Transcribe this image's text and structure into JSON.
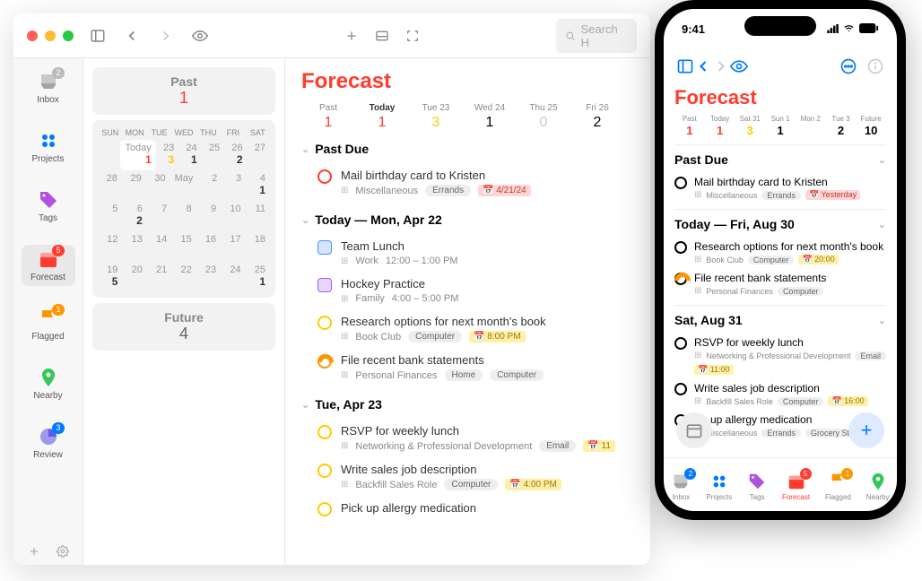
{
  "mac": {
    "search_placeholder": "Search H",
    "sidebar": [
      {
        "label": "Inbox",
        "badge": "2",
        "badgeColor": "",
        "icon": "inbox"
      },
      {
        "label": "Projects",
        "badge": "",
        "icon": "projects"
      },
      {
        "label": "Tags",
        "badge": "",
        "icon": "tags"
      },
      {
        "label": "Forecast",
        "badge": "5",
        "badgeColor": "red",
        "icon": "forecast",
        "selected": true
      },
      {
        "label": "Flagged",
        "badge": "1",
        "badgeColor": "orange",
        "icon": "flagged"
      },
      {
        "label": "Nearby",
        "badge": "",
        "icon": "nearby"
      },
      {
        "label": "Review",
        "badge": "3",
        "badgeColor": "blue",
        "icon": "review"
      }
    ],
    "past_title": "Past",
    "past_count": "1",
    "future_title": "Future",
    "future_count": "4",
    "cal_dow": [
      "SUN",
      "MON",
      "TUE",
      "WED",
      "THU",
      "FRI",
      "SAT"
    ],
    "cal_weeks": [
      [
        {
          "d": "",
          "n": ""
        },
        {
          "d": "Today",
          "n": "1",
          "c": "n-red",
          "today": true
        },
        {
          "d": "23",
          "n": "3",
          "c": "n-yellow"
        },
        {
          "d": "24",
          "n": "1",
          "c": ""
        },
        {
          "d": "25",
          "n": "",
          "c": ""
        },
        {
          "d": "26",
          "n": "2",
          "c": ""
        },
        {
          "d": "27",
          "n": ""
        }
      ],
      [
        {
          "d": "28",
          "n": ""
        },
        {
          "d": "29",
          "n": ""
        },
        {
          "d": "30",
          "n": ""
        },
        {
          "d": "May",
          "n": ""
        },
        {
          "d": "2",
          "n": ""
        },
        {
          "d": "3",
          "n": ""
        },
        {
          "d": "4",
          "n": "1",
          "c": ""
        }
      ],
      [
        {
          "d": "5",
          "n": ""
        },
        {
          "d": "6",
          "n": "2"
        },
        {
          "d": "7",
          "n": ""
        },
        {
          "d": "8",
          "n": ""
        },
        {
          "d": "9",
          "n": ""
        },
        {
          "d": "10",
          "n": ""
        },
        {
          "d": "11",
          "n": ""
        }
      ],
      [
        {
          "d": "12",
          "n": ""
        },
        {
          "d": "13",
          "n": ""
        },
        {
          "d": "14",
          "n": ""
        },
        {
          "d": "15",
          "n": ""
        },
        {
          "d": "16",
          "n": ""
        },
        {
          "d": "17",
          "n": ""
        },
        {
          "d": "18",
          "n": ""
        }
      ],
      [
        {
          "d": "19",
          "n": "5",
          "c": ""
        },
        {
          "d": "20",
          "n": ""
        },
        {
          "d": "21",
          "n": ""
        },
        {
          "d": "22",
          "n": ""
        },
        {
          "d": "23",
          "n": ""
        },
        {
          "d": "24",
          "n": ""
        },
        {
          "d": "25",
          "n": "1",
          "c": ""
        }
      ]
    ],
    "forecast_title": "Forecast",
    "fc_dates": [
      {
        "lbl": "Past",
        "num": "1",
        "c": "n-red"
      },
      {
        "lbl": "Today",
        "num": "1",
        "c": "n-red",
        "bold": true
      },
      {
        "lbl": "Tue 23",
        "num": "3",
        "c": "n-yellow"
      },
      {
        "lbl": "Wed 24",
        "num": "1",
        "c": ""
      },
      {
        "lbl": "Thu 25",
        "num": "0",
        "c": "",
        "muted": true
      },
      {
        "lbl": "Fri 26",
        "num": "2",
        "c": ""
      }
    ],
    "sections": [
      {
        "title": "Past Due",
        "items": [
          {
            "kind": "task",
            "circle": "tc-red",
            "title": "Mail birthday card to Kristen",
            "proj": "Miscellaneous",
            "tags": [
              "Errands"
            ],
            "due": "4/21/24",
            "dueRed": true
          }
        ]
      },
      {
        "title": "Today — Mon, Apr 22",
        "items": [
          {
            "kind": "event",
            "ev": "te-blue",
            "title": "Team Lunch",
            "proj": "Work",
            "time": "12:00 – 1:00 PM"
          },
          {
            "kind": "event",
            "ev": "te-purple",
            "title": "Hockey Practice",
            "proj": "Family",
            "time": "4:00 – 5:00 PM"
          },
          {
            "kind": "task",
            "circle": "tc-yellow",
            "title": "Research options for next month's book",
            "proj": "Book Club",
            "tags": [
              "Computer"
            ],
            "due": "8:00 PM"
          },
          {
            "kind": "task",
            "circle": "tc-orange",
            "ring": true,
            "title": "File recent bank statements",
            "proj": "Personal Finances",
            "tags": [
              "Home",
              "Computer"
            ]
          }
        ]
      },
      {
        "title": "Tue, Apr 23",
        "items": [
          {
            "kind": "task",
            "circle": "tc-yellow",
            "title": "RSVP for weekly lunch",
            "proj": "Networking & Professional Development",
            "tags": [
              "Email"
            ],
            "due": "11"
          },
          {
            "kind": "task",
            "circle": "tc-yellow",
            "title": "Write sales job description",
            "proj": "Backfill Sales Role",
            "tags": [
              "Computer"
            ],
            "due": "4:00 PM"
          },
          {
            "kind": "task",
            "circle": "tc-yellow",
            "title": "Pick up allergy medication"
          }
        ]
      }
    ]
  },
  "phone": {
    "time": "9:41",
    "forecast_title": "Forecast",
    "dates": [
      {
        "lbl": "Past",
        "num": "1",
        "c": "n-red"
      },
      {
        "lbl": "Today",
        "num": "1",
        "c": "n-red"
      },
      {
        "lbl": "Sat 31",
        "num": "3",
        "c": "n-yellow"
      },
      {
        "lbl": "Sun 1",
        "num": "1"
      },
      {
        "lbl": "Mon 2",
        "num": ""
      },
      {
        "lbl": "Tue 3",
        "num": "2"
      },
      {
        "lbl": "Future",
        "num": "10"
      }
    ],
    "sections": [
      {
        "title": "Past Due",
        "items": [
          {
            "circle": "tc-red",
            "title": "Mail birthday card to Kristen",
            "proj": "Miscellaneous",
            "tags": [
              "Errands"
            ],
            "due": "Yesterday",
            "dueRed": true
          }
        ]
      },
      {
        "title": "Today — Fri, Aug 30",
        "items": [
          {
            "circle": "tc-yellow",
            "title": "Research options for next month's book",
            "proj": "Book Club",
            "tags": [
              "Computer"
            ],
            "due": "20:00"
          },
          {
            "circle": "tc-orange",
            "ring": true,
            "title": "File recent bank statements",
            "proj": "Personal Finances",
            "tags": [
              "Computer"
            ]
          }
        ]
      },
      {
        "title": "Sat, Aug 31",
        "items": [
          {
            "circle": "tc-yellow",
            "title": "RSVP for weekly lunch",
            "proj": "Networking & Professional Development",
            "tags": [
              "Email"
            ],
            "due": "11:00"
          },
          {
            "circle": "tc-yellow",
            "title": "Write sales job description",
            "proj": "Backfill Sales Role",
            "tags": [
              "Computer"
            ],
            "due": "16:00"
          },
          {
            "circle": "",
            "title": "ick up allergy medication",
            "proj": "Miscellaneous",
            "tags": [
              "Errands",
              "Grocery Store"
            ]
          }
        ]
      }
    ],
    "tabs": [
      {
        "label": "Inbox",
        "badge": "2"
      },
      {
        "label": "Projects"
      },
      {
        "label": "Tags"
      },
      {
        "label": "Forecast",
        "badge": "5",
        "active": true
      },
      {
        "label": "Flagged",
        "badge": "1"
      },
      {
        "label": "Nearby"
      }
    ]
  }
}
